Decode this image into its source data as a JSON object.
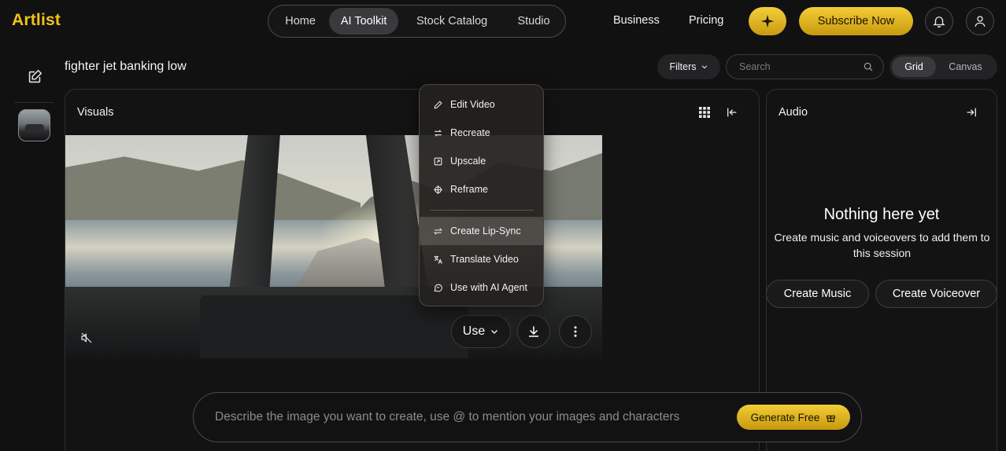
{
  "brand": {
    "logo_text": "Artlist",
    "accent": "#f0c419"
  },
  "nav": {
    "tabs": [
      {
        "label": "Home"
      },
      {
        "label": "AI Toolkit",
        "active": true
      },
      {
        "label": "Stock Catalog"
      },
      {
        "label": "Studio"
      }
    ],
    "links": {
      "business": "Business",
      "pricing": "Pricing"
    },
    "spark_icon": "sparkle-icon",
    "subscribe_label": "Subscribe Now"
  },
  "session": {
    "title": "fighter jet banking low",
    "filters_label": "Filters",
    "search_placeholder": "Search",
    "view_toggle": [
      {
        "label": "Grid",
        "active": true
      },
      {
        "label": "Canvas"
      }
    ]
  },
  "visuals": {
    "title": "Visuals",
    "use_label": "Use",
    "menu": [
      {
        "label": "Edit Video",
        "icon": "pencil-icon"
      },
      {
        "label": "Recreate",
        "icon": "swap-arrows-icon"
      },
      {
        "label": "Upscale",
        "icon": "upscale-icon"
      },
      {
        "label": "Reframe",
        "icon": "reframe-icon"
      },
      {
        "label": "Create Lip-Sync",
        "icon": "exchange-icon",
        "highlighted": true
      },
      {
        "label": "Translate Video",
        "icon": "translate-icon"
      },
      {
        "label": "Use with AI Agent",
        "icon": "chat-icon"
      }
    ]
  },
  "audio": {
    "title": "Audio",
    "empty_title": "Nothing here yet",
    "empty_desc": "Create music and voiceovers to add them to this session",
    "create_music_label": "Create Music",
    "create_voiceover_label": "Create Voiceover"
  },
  "prompt": {
    "placeholder": "Describe the image you want to create, use @ to mention your images and characters",
    "generate_label": "Generate Free"
  }
}
